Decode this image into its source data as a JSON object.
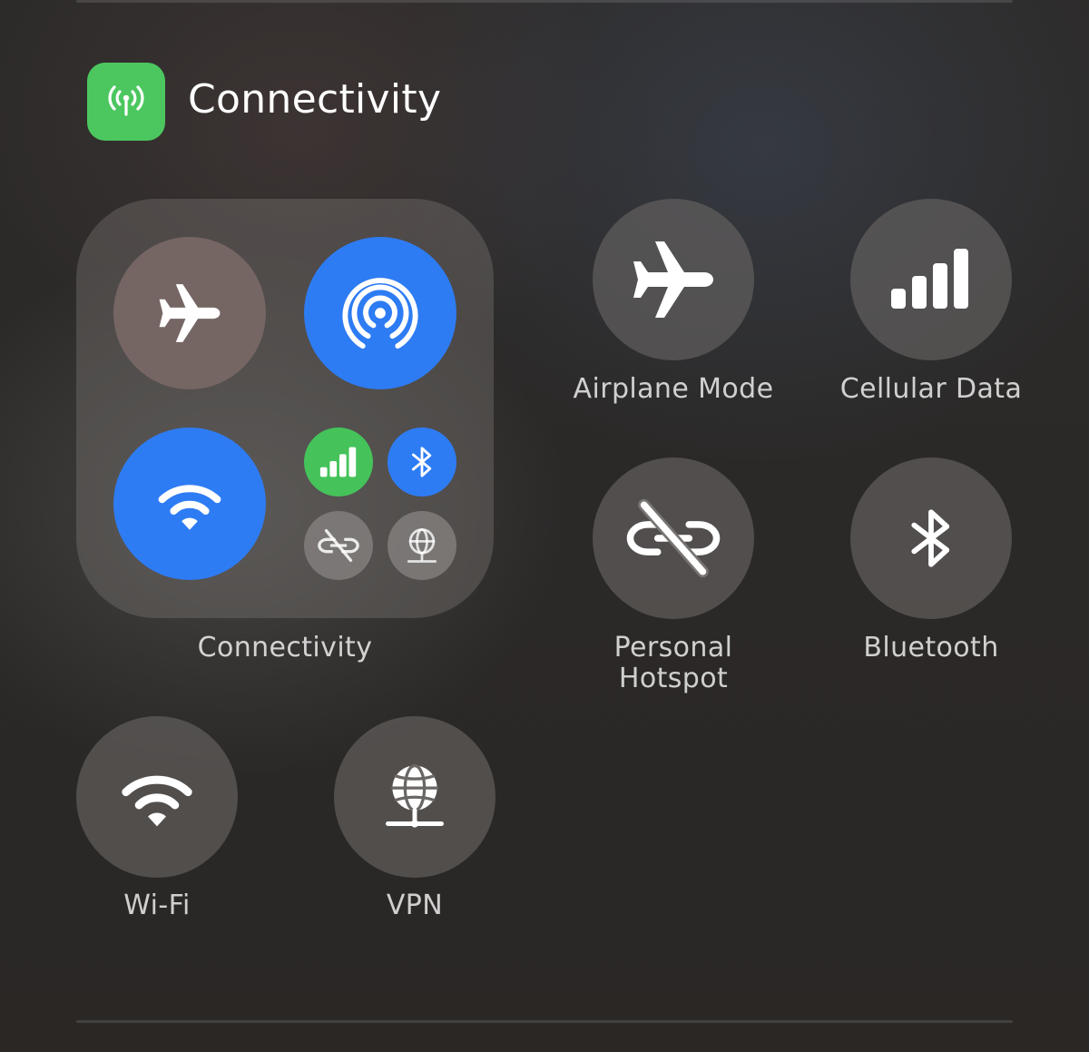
{
  "section": {
    "title": "Connectivity",
    "icon": "antenna-radiowaves-icon",
    "icon_color": "#4cc75f"
  },
  "module": {
    "label": "Connectivity",
    "controls": [
      {
        "name": "airplane-mode",
        "icon": "airplane-icon",
        "state": "off"
      },
      {
        "name": "airdrop",
        "icon": "airdrop-icon",
        "state": "on",
        "color": "#2e7cf3"
      },
      {
        "name": "wifi",
        "icon": "wifi-icon",
        "state": "on",
        "color": "#2e7cf3"
      },
      {
        "name": "cellular-data",
        "icon": "cellular-bars-icon",
        "state": "on",
        "color": "#45c35a"
      },
      {
        "name": "bluetooth",
        "icon": "bluetooth-icon",
        "state": "on",
        "color": "#2e7cf3"
      },
      {
        "name": "personal-hotspot",
        "icon": "hotspot-link-slash-icon",
        "state": "off"
      },
      {
        "name": "vpn",
        "icon": "vpn-globe-icon",
        "state": "off"
      }
    ]
  },
  "controls": {
    "airplane": {
      "label": "Airplane Mode",
      "icon": "airplane-icon"
    },
    "cellular": {
      "label": "Cellular Data",
      "icon": "cellular-bars-icon"
    },
    "hotspot": {
      "label_line1": "Personal",
      "label_line2": "Hotspot",
      "icon": "hotspot-link-slash-icon"
    },
    "bluetooth": {
      "label": "Bluetooth",
      "icon": "bluetooth-icon"
    },
    "wifi": {
      "label": "Wi-Fi",
      "icon": "wifi-icon"
    },
    "vpn": {
      "label": "VPN",
      "icon": "vpn-globe-icon"
    }
  }
}
